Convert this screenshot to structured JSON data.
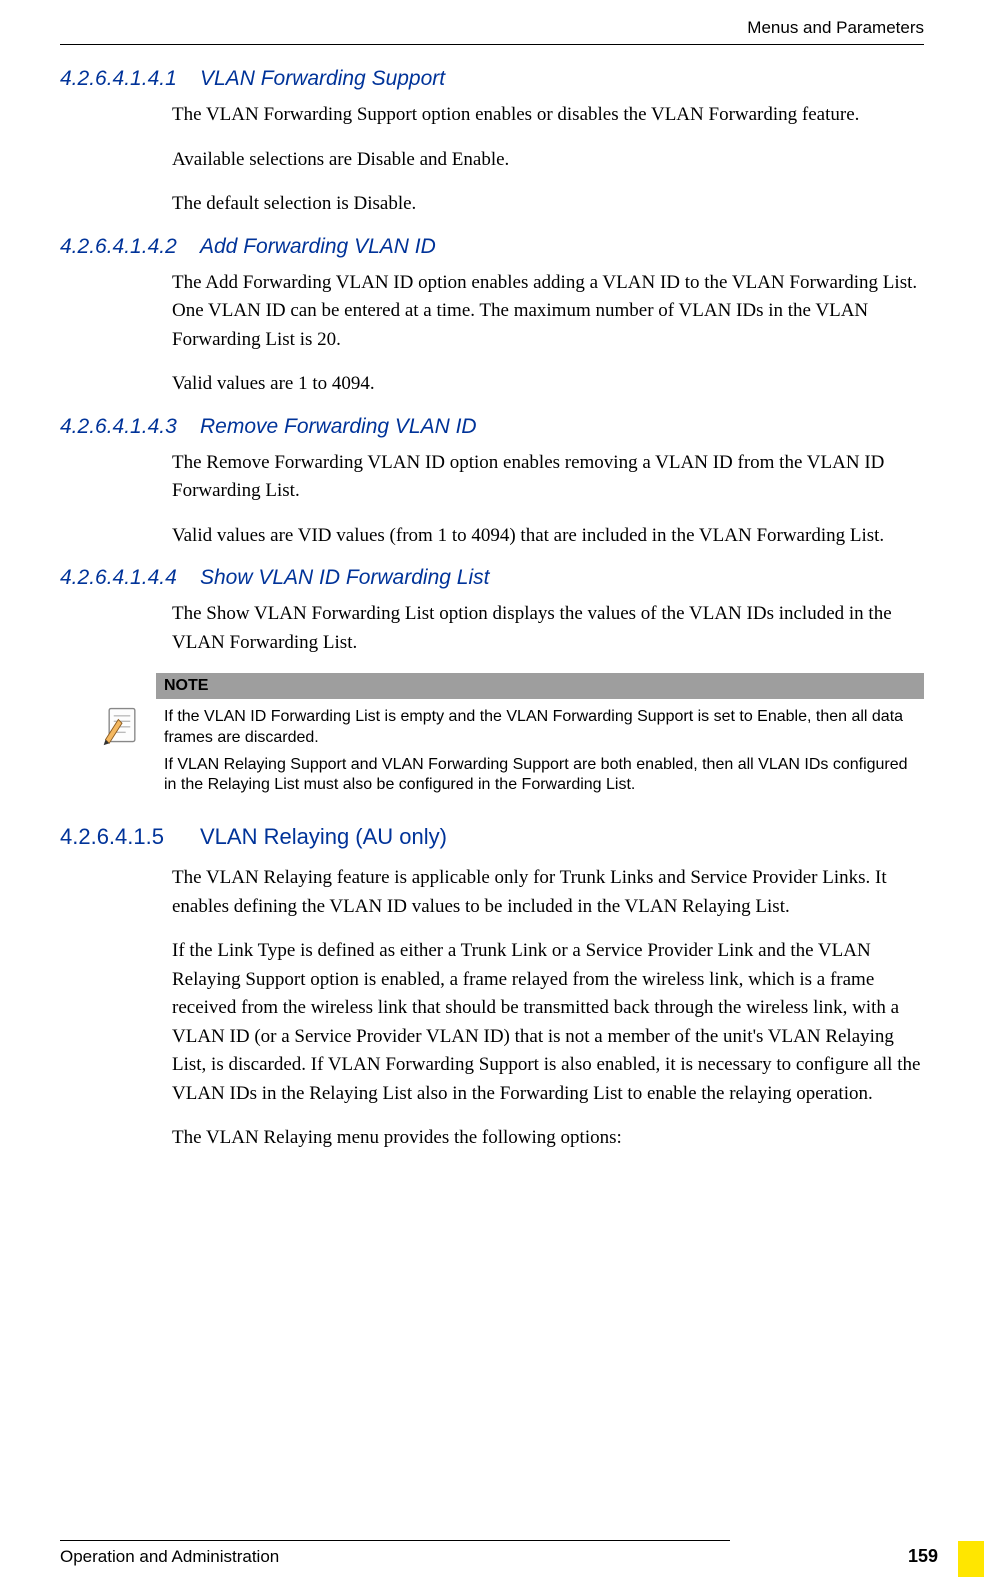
{
  "header": {
    "right": "Menus and Parameters"
  },
  "sections": [
    {
      "num": "4.2.6.4.1.4.1",
      "title": "VLAN Forwarding Support",
      "paras": [
        "The VLAN Forwarding Support option enables or disables the VLAN Forwarding feature.",
        "Available selections are Disable and Enable.",
        "The default selection is Disable."
      ]
    },
    {
      "num": "4.2.6.4.1.4.2",
      "title": "Add Forwarding VLAN ID",
      "paras": [
        "The Add Forwarding VLAN ID option enables adding a VLAN ID to the VLAN Forwarding List. One VLAN ID can be entered at a time. The maximum number of VLAN IDs in the VLAN Forwarding List is 20.",
        "Valid values are 1 to 4094."
      ]
    },
    {
      "num": "4.2.6.4.1.4.3",
      "title": "Remove Forwarding VLAN ID",
      "paras": [
        "The Remove Forwarding VLAN ID option enables removing a VLAN ID from the VLAN ID Forwarding List.",
        "Valid values are VID values (from 1 to 4094) that are included in the VLAN Forwarding List."
      ]
    },
    {
      "num": "4.2.6.4.1.4.4",
      "title": "Show VLAN ID Forwarding List",
      "paras": [
        "The Show VLAN Forwarding List option displays the values of the VLAN IDs included in the VLAN Forwarding List."
      ]
    }
  ],
  "note": {
    "label": "NOTE",
    "p1": "If the VLAN ID Forwarding List is empty and the VLAN Forwarding Support is set to Enable, then all data frames are discarded.",
    "p2": "If VLAN Relaying Support and VLAN Forwarding Support are both enabled, then all VLAN IDs configured in the Relaying List must also be configured in the Forwarding List."
  },
  "section5": {
    "num": "4.2.6.4.1.5",
    "title": "VLAN Relaying (AU only)",
    "paras": [
      "The VLAN Relaying feature is applicable only for Trunk Links and Service Provider Links. It enables defining the VLAN ID values to be included in the VLAN Relaying List.",
      "If the Link Type is defined as either a Trunk Link or a Service Provider Link and the VLAN Relaying Support option is enabled, a frame relayed from the wireless link, which is a frame received from the wireless link that should be transmitted back through the wireless link, with a VLAN ID (or a Service Provider VLAN ID) that is not a member of the unit's VLAN Relaying List, is discarded. If VLAN Forwarding Support is also enabled, it is necessary to configure all the VLAN IDs in the Relaying List also in the Forwarding List to enable the relaying operation.",
      "The VLAN Relaying menu provides the following options:"
    ]
  },
  "footer": {
    "left": "Operation and Administration",
    "page": "159"
  }
}
